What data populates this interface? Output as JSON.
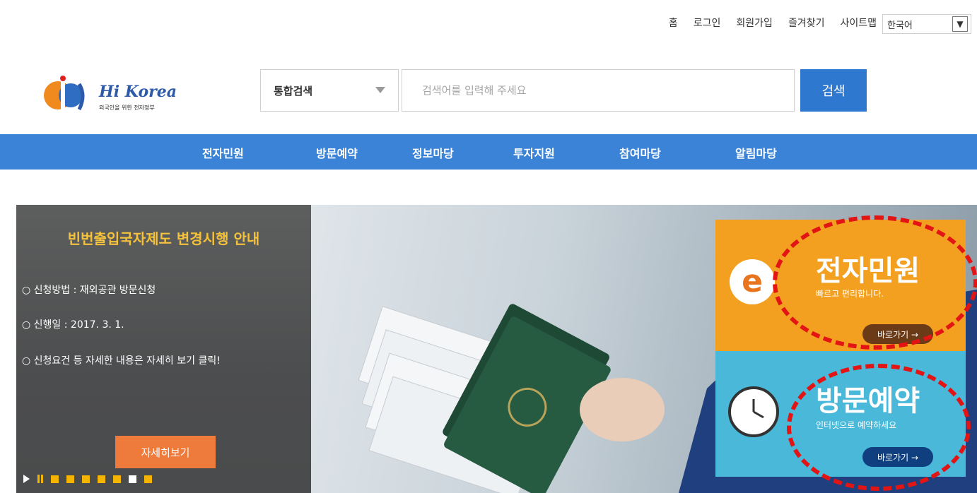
{
  "utility_links": [
    "홈",
    "로그인",
    "회원가입",
    "즐겨찾기",
    "사이트맵"
  ],
  "language": {
    "selected": "한국어"
  },
  "logo": {
    "title": "Hi Korea",
    "subtitle": "외국인을 위한 전자정부"
  },
  "search": {
    "category": "통합검색",
    "placeholder": "검색어를 입력해 주세요",
    "button": "검색"
  },
  "nav": [
    "전자민원",
    "방문예약",
    "정보마당",
    "투자지원",
    "참여마당",
    "알림마당"
  ],
  "notice": {
    "title": "빈번출입국자제도 변경시행 안내",
    "lines": [
      "○ 신청방법 : 재외공관 방문신청",
      "○ 신행일 : 2017. 3. 1.",
      "○ 신청요건 등 자세한 내용은 자세히 보기 클릭!"
    ],
    "button": "자세히보기"
  },
  "cards": {
    "e_civil": {
      "icon_letter": "e",
      "title": "전자민원",
      "desc": "빠르고 편리합니다.",
      "button": "바로가기 →"
    },
    "visit": {
      "title": "방문예약",
      "desc": "인터넷으로 예약하세요",
      "button": "바로가기 →"
    }
  },
  "colors": {
    "nav": "#3a83d6",
    "orange": "#f3a021",
    "sky": "#49b8d9",
    "highlight": "#e31414"
  }
}
